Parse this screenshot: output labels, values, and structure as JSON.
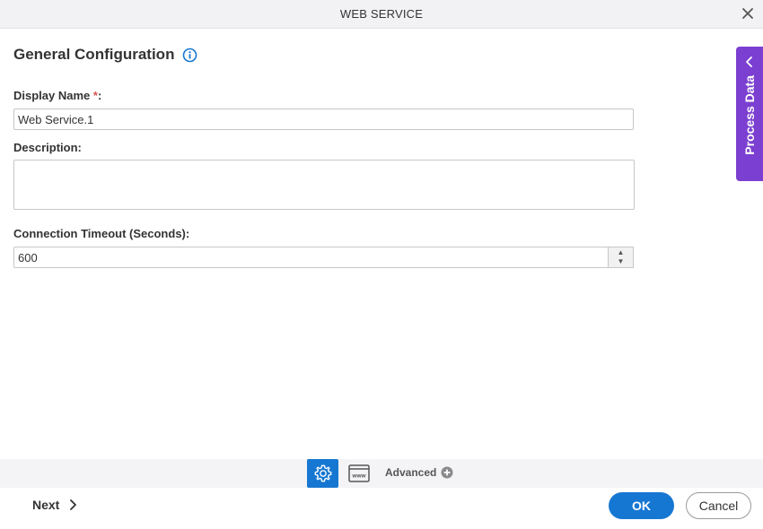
{
  "window": {
    "title": "WEB SERVICE"
  },
  "section": {
    "title": "General Configuration"
  },
  "fields": {
    "display_name": {
      "label": "Display Name",
      "required_mark": "*",
      "suffix": ":",
      "value": "Web Service.1"
    },
    "description": {
      "label": "Description:",
      "value": ""
    },
    "connection_timeout": {
      "label": "Connection Timeout (Seconds):",
      "value": "600"
    }
  },
  "side_panel": {
    "label": "Process Data"
  },
  "tabs": {
    "advanced_label": "Advanced"
  },
  "footer": {
    "next_label": "Next",
    "ok_label": "OK",
    "cancel_label": "Cancel"
  },
  "colors": {
    "accent": "#1677d2",
    "process_tab": "#7b3fd1",
    "required": "#d9534f"
  },
  "icons": [
    "close-icon",
    "info-icon",
    "chevron-left-icon",
    "gear-icon",
    "www-icon",
    "plus-circle-icon",
    "chevron-right-icon"
  ]
}
